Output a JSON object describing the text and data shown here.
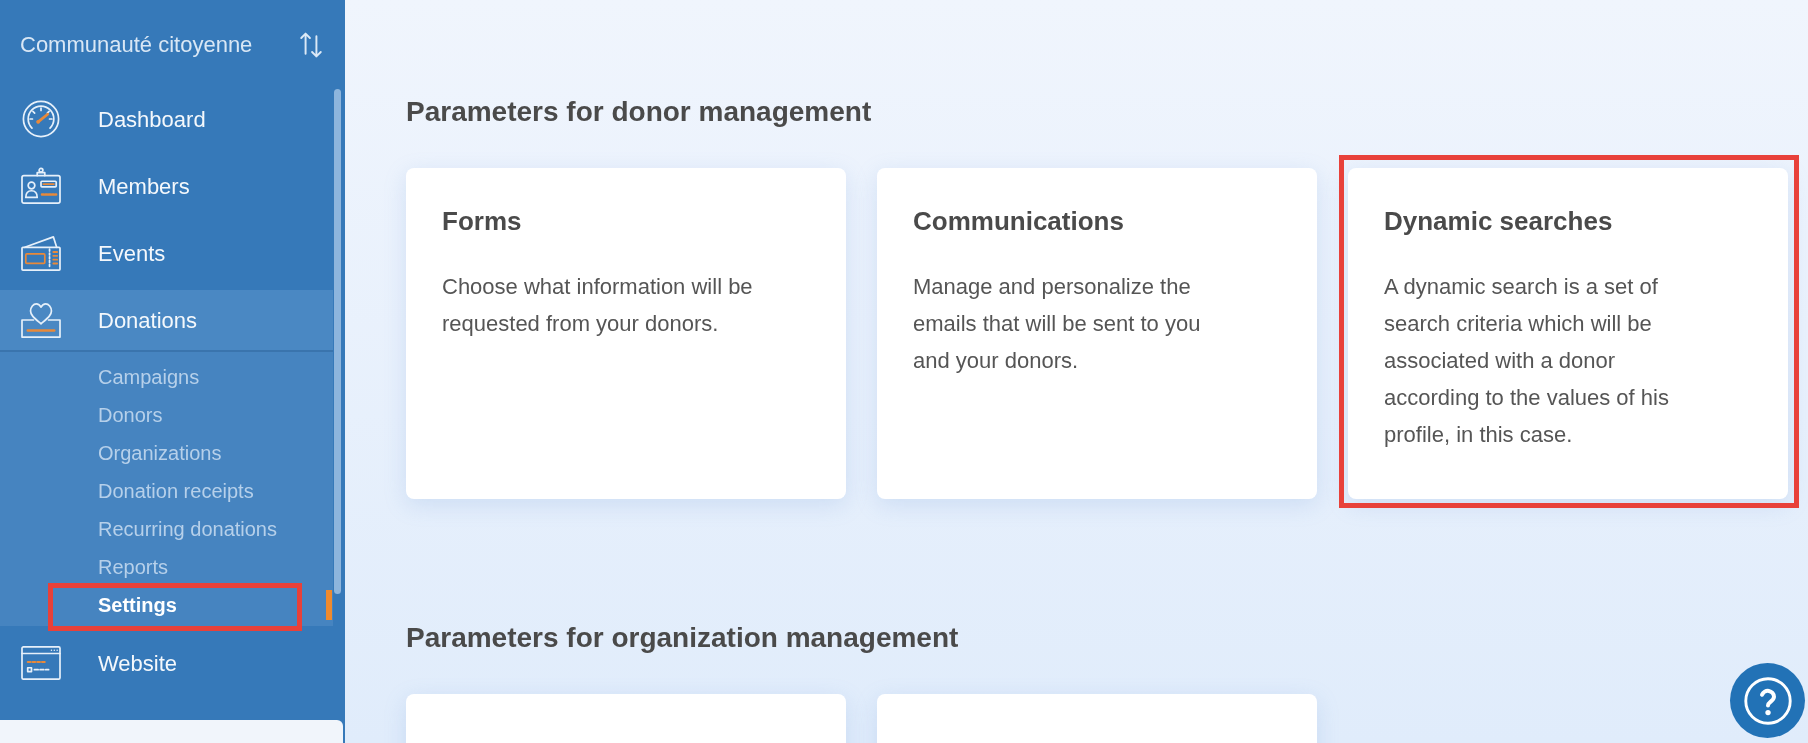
{
  "sidebar": {
    "organization": "Communauté citoyenne",
    "items": [
      {
        "label": "Dashboard",
        "selected": false
      },
      {
        "label": "Members",
        "selected": false
      },
      {
        "label": "Events",
        "selected": false
      },
      {
        "label": "Donations",
        "selected": true,
        "children": [
          {
            "label": "Campaigns",
            "selected": false,
            "highlighted": false
          },
          {
            "label": "Donors",
            "selected": false,
            "highlighted": false
          },
          {
            "label": "Organizations",
            "selected": false,
            "highlighted": false
          },
          {
            "label": "Donation receipts",
            "selected": false,
            "highlighted": false
          },
          {
            "label": "Recurring donations",
            "selected": false,
            "highlighted": false
          },
          {
            "label": "Reports",
            "selected": false,
            "highlighted": false
          },
          {
            "label": "Settings",
            "selected": true,
            "highlighted": true
          }
        ]
      },
      {
        "label": "Website",
        "selected": false
      }
    ]
  },
  "donor_section": {
    "heading": "Parameters for donor management",
    "cards": [
      {
        "title": "Forms",
        "description": "Choose what information will be requested from your donors.",
        "highlighted": false
      },
      {
        "title": "Communications",
        "description": "Manage and personalize the emails that will be sent to you and your donors.",
        "highlighted": false
      },
      {
        "title": "Dynamic searches",
        "description": "A dynamic search is a set of search criteria which will be associated with a donor according to the values of his profile, in this case.",
        "highlighted": true
      }
    ]
  },
  "organization_section": {
    "heading": "Parameters for organization management"
  }
}
